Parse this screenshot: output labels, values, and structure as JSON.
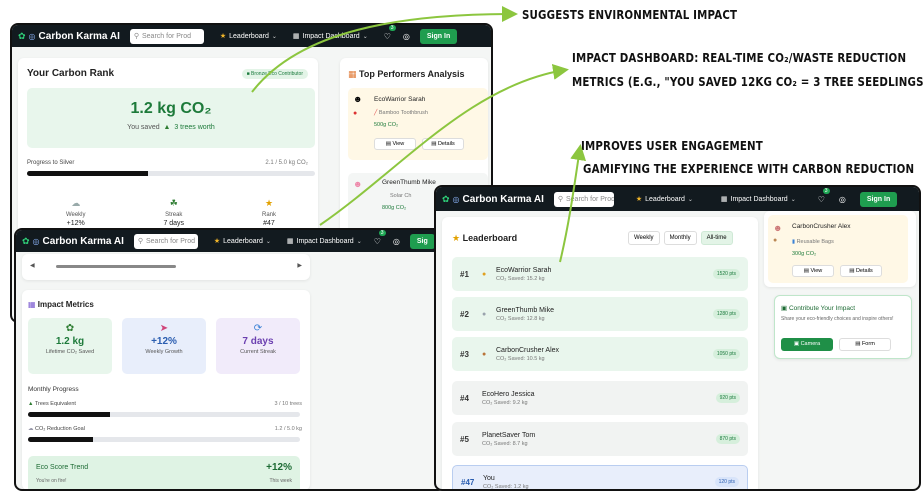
{
  "annotations": {
    "a1": "SUGGESTS ENVIRONMENTAL IMPACT",
    "a2_line1": "IMPACT DASHBOARD: REAL-TIME CO₂/WASTE REDUCTION",
    "a2_line2": "METRICS (E.G., \"YOU SAVED 12KG CO₂ = 3 TREE SEEDLINGS\").",
    "a3_line1": "IMPROVES USER  ENGAGEMENT",
    "a3_line2": "GAMIFYING THE EXPERIENCE WITH CARBON REDUCTION"
  },
  "nav": {
    "app_title": "Carbon Karma AI",
    "search_placeholder": "Search for Prod",
    "leaderboard": "Leaderboard",
    "impact_dashboard": "Impact Dashboard",
    "notif_count": "3",
    "sign_in": "Sign In",
    "sign_in_short": "Sig"
  },
  "rank_card": {
    "title": "Your Carbon Rank",
    "badge": "Bronze Eco Contributor",
    "amount": "1.2 kg CO₂",
    "saved_prefix": "You saved",
    "saved_suffix": "3 trees worth",
    "progress_label": "Progress to Silver",
    "progress_value": "2.1 / 5.0 kg CO₂",
    "progress_fraction": 0.42,
    "stats": [
      {
        "label": "Weekly",
        "value": "+12%"
      },
      {
        "label": "Streak",
        "value": "7 days"
      },
      {
        "label": "Rank",
        "value": "#47"
      }
    ]
  },
  "top_perf": {
    "title": "Top Performers Analysis",
    "first_name": "EcoWarrior Sarah",
    "first_product": "Bamboo Toothbrush",
    "first_co2": "500g CO₂",
    "view": "View",
    "details": "Details",
    "second_name": "GreenThumb Mike",
    "second_product": "Solar Ch",
    "second_co2": "800g CO₂"
  },
  "impact_metrics": {
    "title": "Impact Metrics",
    "tiles": [
      {
        "value": "1.2 kg",
        "label": "Lifetime CO₂ Saved",
        "color": "#1d7a3a"
      },
      {
        "value": "+12%",
        "label": "Weekly Growth",
        "color": "#2a5db0"
      },
      {
        "value": "7 days",
        "label": "Current Streak",
        "color": "#6b3fb0"
      }
    ],
    "monthly_title": "Monthly Progress",
    "trees_label": "Trees Equivalent",
    "trees_value": "3 / 10 trees",
    "trees_fraction": 0.3,
    "co2_label": "CO₂ Reduction Goal",
    "co2_value": "1.2 / 5.0 kg",
    "co2_fraction": 0.24,
    "trend_title": "Eco Score Trend",
    "trend_value": "+12%",
    "trend_sub": "You're on fire!",
    "trend_period": "This week"
  },
  "leaderboard": {
    "title": "Leaderboard",
    "tabs": [
      "Weekly",
      "Monthly",
      "All-time"
    ],
    "rows": [
      {
        "rank": "#1",
        "name": "EcoWarrior Sarah",
        "saved": "CO₂ Saved: 15.2 kg",
        "pts": "1520 pts",
        "medal": "🏅"
      },
      {
        "rank": "#2",
        "name": "GreenThumb Mike",
        "saved": "CO₂ Saved: 12.8 kg",
        "pts": "1280 pts",
        "medal": "🏅"
      },
      {
        "rank": "#3",
        "name": "CarbonCrusher Alex",
        "saved": "CO₂ Saved: 10.5 kg",
        "pts": "1050 pts",
        "medal": "🏅"
      },
      {
        "rank": "#4",
        "name": "EcoHero Jessica",
        "saved": "CO₂ Saved: 9.2 kg",
        "pts": "920 pts",
        "medal": ""
      },
      {
        "rank": "#5",
        "name": "PlanetSaver Tom",
        "saved": "CO₂ Saved: 8.7 kg",
        "pts": "870 pts",
        "medal": ""
      },
      {
        "rank": "#47",
        "name": "You",
        "saved": "CO₂ Saved: 1.2 kg",
        "pts": "120 pts",
        "medal": ""
      }
    ]
  },
  "side_card": {
    "name": "CarbonCrusher Alex",
    "product": "Reusable Bags",
    "co2": "300g CO₂",
    "view": "View",
    "details": "Details"
  },
  "contribute": {
    "title": "Contribute Your Impact",
    "desc": "Share your eco-friendly choices and inspire others!",
    "camera": "Camera",
    "form": "Form"
  },
  "colors": {
    "nav_bg": "#121a1f",
    "accent_green": "#1f9d4f",
    "arrow_green": "#8cc63f"
  }
}
